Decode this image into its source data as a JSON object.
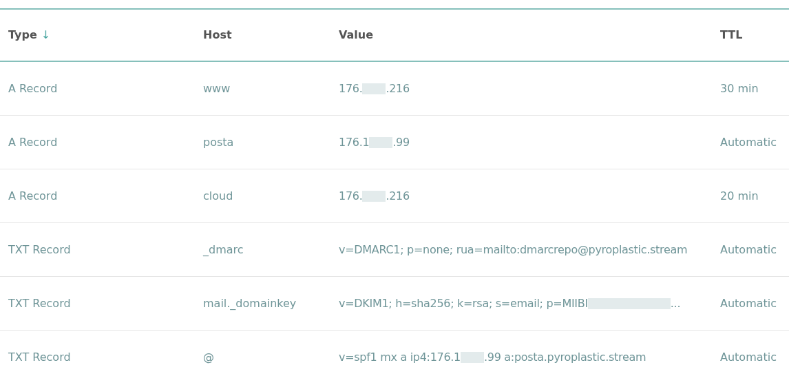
{
  "table": {
    "columns": [
      {
        "label": "Type",
        "sort_indicator": "↓"
      },
      {
        "label": "Host"
      },
      {
        "label": "Value"
      },
      {
        "label": "TTL"
      }
    ],
    "rows": [
      {
        "type": "A Record",
        "host": "www",
        "value": [
          {
            "kind": "text",
            "text": "176."
          },
          {
            "kind": "redacted"
          },
          {
            "kind": "text",
            "text": ".216"
          }
        ],
        "ttl": "30 min"
      },
      {
        "type": "A Record",
        "host": "posta",
        "value": [
          {
            "kind": "text",
            "text": "176.1"
          },
          {
            "kind": "redacted"
          },
          {
            "kind": "text",
            "text": ".99"
          }
        ],
        "ttl": "Automatic"
      },
      {
        "type": "A Record",
        "host": "cloud",
        "value": [
          {
            "kind": "text",
            "text": "176."
          },
          {
            "kind": "redacted"
          },
          {
            "kind": "text",
            "text": ".216"
          }
        ],
        "ttl": "20 min"
      },
      {
        "type": "TXT Record",
        "host": "_dmarc",
        "value": [
          {
            "kind": "text",
            "text": "v=DMARC1; p=none; rua=mailto:dmarcrepo@pyroplastic.stream"
          }
        ],
        "ttl": "Automatic"
      },
      {
        "type": "TXT Record",
        "host": "mail._domainkey",
        "value": [
          {
            "kind": "text",
            "text": "v=DKIM1; h=sha256; k=rsa; s=email; p=MIIBI"
          },
          {
            "kind": "redacted"
          },
          {
            "kind": "text",
            "text": "..."
          }
        ],
        "ttl": "Automatic"
      },
      {
        "type": "TXT Record",
        "host": "@",
        "value": [
          {
            "kind": "text",
            "text": "v=spf1 mx a ip4:176.1"
          },
          {
            "kind": "redacted"
          },
          {
            "kind": "text",
            "text": ".99 a:posta.pyroplastic.stream"
          }
        ],
        "ttl": "Automatic"
      }
    ]
  }
}
